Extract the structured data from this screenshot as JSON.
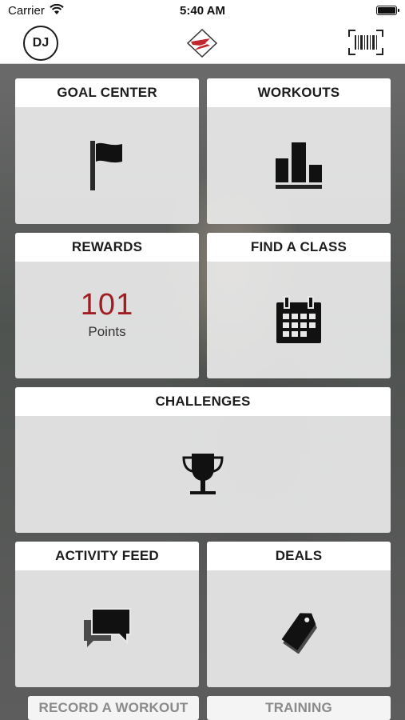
{
  "status_bar": {
    "carrier": "Carrier",
    "time": "5:40 AM"
  },
  "nav": {
    "avatar_initials": "DJ",
    "logo_icon": "brand-logo-icon",
    "barcode_icon": "barcode-icon"
  },
  "tiles": {
    "goal_center": {
      "label": "GOAL CENTER",
      "icon": "flag-icon"
    },
    "workouts": {
      "label": "WORKOUTS",
      "icon": "bar-chart-icon"
    },
    "rewards": {
      "label": "REWARDS",
      "points_value": "101",
      "points_label": "Points"
    },
    "find_a_class": {
      "label": "FIND A CLASS",
      "icon": "calendar-icon"
    },
    "challenges": {
      "label": "CHALLENGES",
      "icon": "trophy-icon"
    },
    "activity_feed": {
      "label": "ACTIVITY FEED",
      "icon": "chat-bubbles-icon"
    },
    "deals": {
      "label": "DEALS",
      "icon": "tag-icon"
    },
    "record_a_workout": {
      "label": "RECORD A WORKOUT"
    },
    "training": {
      "label": "TRAINING"
    }
  },
  "colors": {
    "accent": "#a01e23",
    "tile_bg": "#e8e8e8",
    "header_bg": "#ffffff"
  }
}
